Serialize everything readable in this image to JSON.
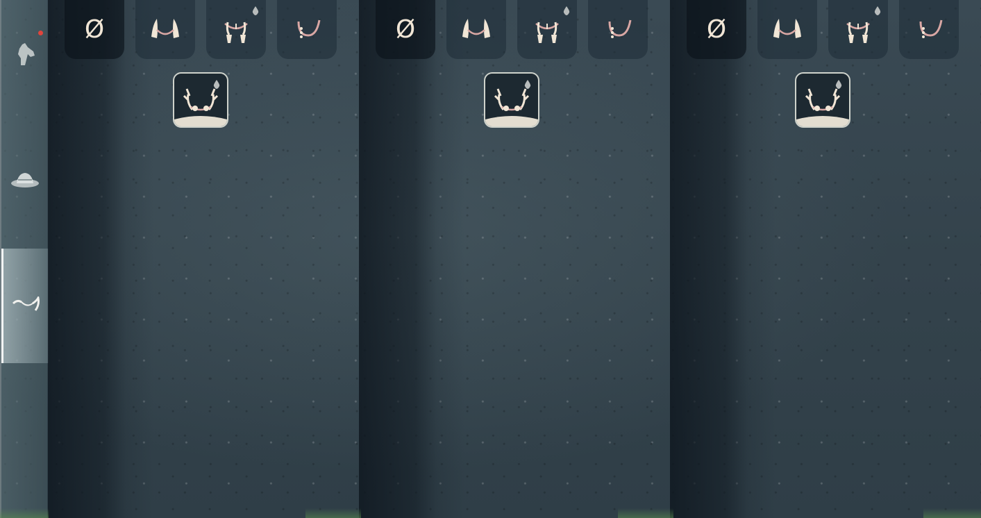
{
  "sidebar": {
    "items": [
      {
        "icon": "horse-head-icon",
        "active": false,
        "notification": true
      },
      {
        "icon": "hat-icon",
        "active": false,
        "notification": false
      },
      {
        "icon": "horns-icon",
        "active": true,
        "notification": false
      }
    ]
  },
  "panels": [
    {
      "slots": [
        {
          "icon": "none-icon",
          "glyph": "Ø",
          "premium": false
        },
        {
          "icon": "tusk-horns-icon",
          "premium": false
        },
        {
          "icon": "tassel-horns-icon",
          "premium": true
        },
        {
          "icon": "single-hook-horn-icon",
          "premium": false
        }
      ],
      "selected": {
        "icon": "antlers-icon",
        "premium": true
      }
    },
    {
      "slots": [
        {
          "icon": "none-icon",
          "glyph": "Ø",
          "premium": false
        },
        {
          "icon": "tusk-horns-icon",
          "premium": false
        },
        {
          "icon": "tassel-horns-icon",
          "premium": true
        },
        {
          "icon": "single-hook-horn-icon",
          "premium": false
        }
      ],
      "selected": {
        "icon": "antlers-icon",
        "premium": true
      }
    },
    {
      "slots": [
        {
          "icon": "none-icon",
          "glyph": "Ø",
          "premium": false
        },
        {
          "icon": "tusk-horns-icon",
          "premium": false
        },
        {
          "icon": "tassel-horns-icon",
          "premium": true
        },
        {
          "icon": "single-hook-horn-icon",
          "premium": false
        }
      ],
      "selected": {
        "icon": "antlers-icon",
        "premium": true
      }
    }
  ],
  "colors": {
    "icon_cream": "#f1e6d6",
    "icon_pink": "#d9a7a4",
    "notification": "#e0443c",
    "selected_border": "#cfd3cc"
  }
}
